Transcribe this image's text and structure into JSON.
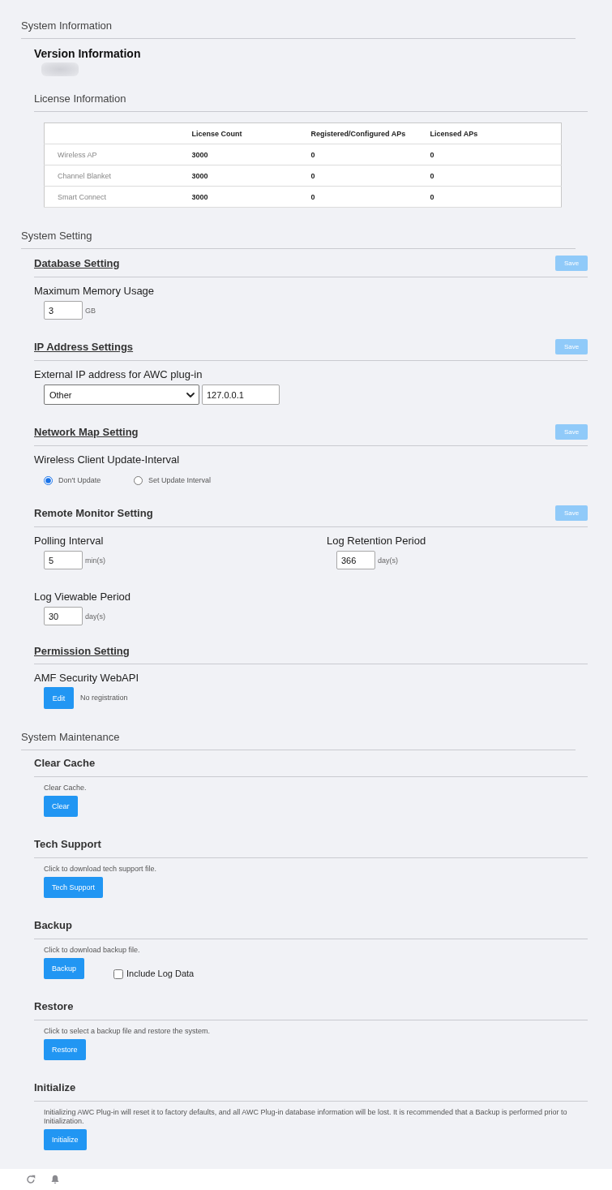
{
  "system_information": {
    "title": "System Information",
    "version": {
      "title": "Version Information"
    },
    "license": {
      "title": "License Information",
      "table": {
        "columns": [
          "License Count",
          "Registered/Configured APs",
          "Licensed APs"
        ],
        "rows": [
          {
            "name": "Wireless AP",
            "values": [
              "3000",
              "0",
              "0"
            ]
          },
          {
            "name": "Channel Blanket",
            "values": [
              "3000",
              "0",
              "0"
            ]
          },
          {
            "name": "Smart Connect",
            "values": [
              "3000",
              "0",
              "0"
            ]
          }
        ]
      }
    }
  },
  "system_setting": {
    "title": "System Setting",
    "groups": [
      {
        "title": "Database Setting",
        "link": true,
        "save": {
          "label": "Save",
          "disabled": true
        },
        "fields": [
          {
            "kind": "number",
            "label": "Maximum Memory Usage",
            "value": "3",
            "unit": "GB"
          }
        ]
      },
      {
        "title": "IP Address Settings",
        "link": true,
        "save": {
          "label": "Save",
          "disabled": true
        },
        "fields": [
          {
            "kind": "select_input",
            "label": "External IP address for AWC plug-in",
            "select": "Other",
            "value": "127.0.0.1"
          }
        ]
      },
      {
        "title": "Network Map Setting",
        "link": true,
        "save": {
          "label": "Save",
          "disabled": true
        },
        "fields": [
          {
            "kind": "radio",
            "label": "Wireless Client Update-Interval",
            "options": [
              {
                "label": "Don't Update",
                "selected": true
              },
              {
                "label": "Set Update Interval",
                "selected": false
              }
            ]
          }
        ]
      },
      {
        "title": "Remote Monitor Setting",
        "link": false,
        "save": {
          "label": "Save",
          "disabled": true
        },
        "fields": [
          {
            "kind": "number",
            "label": "Polling Interval",
            "value": "5",
            "unit": "min(s)"
          },
          {
            "kind": "number",
            "label": "Log Retention Period",
            "value": "366",
            "unit": "day(s)"
          },
          {
            "kind": "number",
            "label": "Log Viewable Period",
            "value": "30",
            "unit": "day(s)"
          }
        ]
      },
      {
        "title": "Permission Setting",
        "link": true,
        "fields": [
          {
            "kind": "action",
            "label": "AMF Security WebAPI",
            "button": "Edit",
            "status": "No registration"
          }
        ]
      }
    ]
  },
  "system_maintenance": {
    "title": "System Maintenance",
    "groups": [
      {
        "title": "Clear Cache",
        "description": "Clear Cache.",
        "button": "Clear"
      },
      {
        "title": "Tech Support",
        "description": "Click to download tech support file.",
        "button": "Tech Support"
      },
      {
        "title": "Backup",
        "description": "Click to download backup file.",
        "button": "Backup",
        "option": {
          "label": "Include Log Data",
          "checked": false
        }
      },
      {
        "title": "Restore",
        "description": "Click to select a backup file and restore the system.",
        "button": "Restore"
      },
      {
        "title": "Initialize",
        "description": "Initializing AWC Plug-in will reset it to factory defaults, and all AWC Plug-in database information will be lost. It is recommended that a Backup is performed prior to Initialization.",
        "button": "Initialize"
      }
    ]
  }
}
